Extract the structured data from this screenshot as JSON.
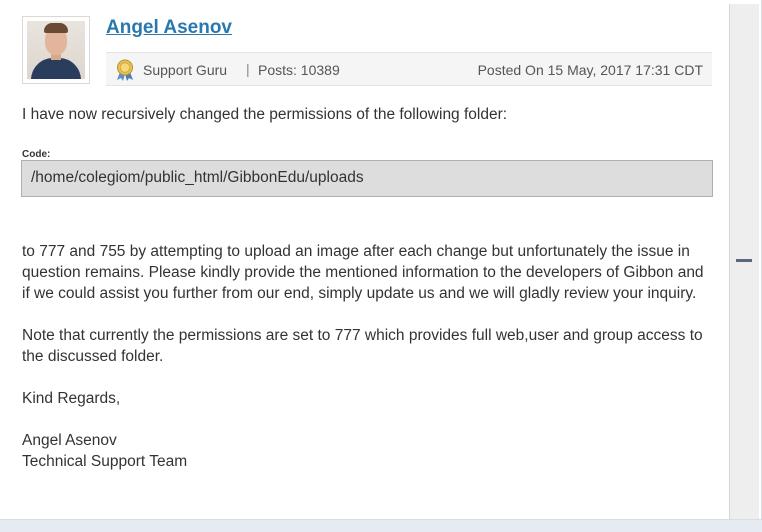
{
  "author": {
    "name": "Angel Asenov",
    "rank": "Support Guru",
    "posts_label": "Posts: 10389",
    "posted_on": "Posted On 15 May, 2017 17:31 CDT"
  },
  "post": {
    "intro": "I have now recursively changed the permissions of the following folder:",
    "code_label": "Code:",
    "code": "/home/colegiom/public_html/GibbonEdu/uploads",
    "paragraphs": [
      "to 777 and 755 by attempting to upload an image after each change but unfortunately the issue in question remains. Please kindly provide the mentioned information to the developers of Gibbon and if we could assist you further from our end, simply update us and we will gladly review your inquiry.",
      "Note that currently the permissions are set to 777 which provides full web,user and group access to the discussed folder.",
      "Kind Regards,"
    ],
    "signature_name": "Angel Asenov",
    "signature_team": "Technical Support Team"
  },
  "icons": {
    "rank_badge": "medal-icon",
    "avatar": "user-avatar-photo"
  },
  "colors": {
    "link": "#2a78ad",
    "code_bg": "#dddddd",
    "meta_bg": "#f5f5f5"
  }
}
